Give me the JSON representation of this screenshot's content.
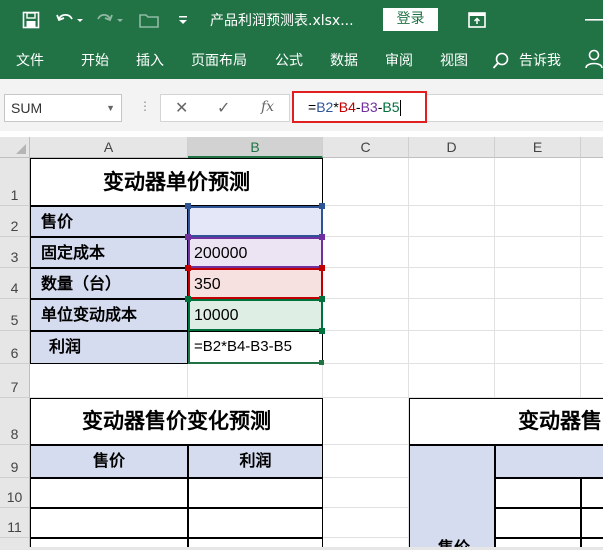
{
  "titlebar": {
    "filename": "产品利润预测表.xlsx...",
    "login_label": "登录",
    "save_icon": "save-icon",
    "undo_icon": "undo-icon",
    "redo_icon": "redo-icon",
    "open_icon": "folder-icon",
    "customize_icon": "customize-icon",
    "restore_icon": "restore-window-icon",
    "accent": "#217346"
  },
  "ribbon": {
    "tabs": [
      "文件",
      "开始",
      "插入",
      "页面布局",
      "公式",
      "数据",
      "审阅",
      "视图"
    ],
    "tell_me": "告诉我",
    "share_icon": "person-icon"
  },
  "formula_bar": {
    "name_box": "SUM",
    "cancel_icon": "✕",
    "enter_icon": "✓",
    "fx_label": "fx",
    "formula": {
      "eq": "=",
      "b2": "B2",
      "op1": "*",
      "b4": "B4",
      "op2": "-",
      "b3": "B3",
      "op3": "-",
      "b5": "B5"
    }
  },
  "sheet": {
    "columns": [
      "A",
      "B",
      "C",
      "D",
      "E"
    ],
    "rows": [
      "1",
      "2",
      "3",
      "4",
      "5",
      "6",
      "7",
      "8",
      "9",
      "10",
      "11"
    ],
    "active_column": "B",
    "table1": {
      "title": "变动器单价预测",
      "labels": [
        "售价",
        "固定成本",
        "数量（台）",
        "单位变动成本",
        "利润"
      ],
      "values": [
        "",
        "200000",
        "350",
        "10000",
        "=B2*B4-B3-B5"
      ]
    },
    "table2": {
      "title": "变动器售价变化预测",
      "col_headers": [
        "售价",
        "利润"
      ]
    },
    "table3": {
      "title_visible": "变动器售",
      "side_label": "售价"
    }
  }
}
